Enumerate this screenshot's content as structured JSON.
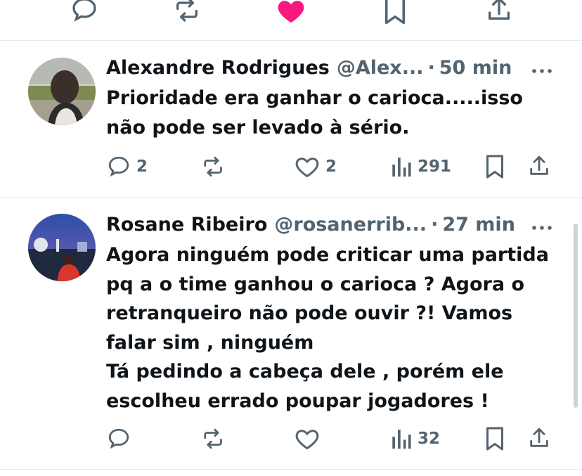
{
  "top_actions": {
    "reply_icon": "reply-icon",
    "retweet_icon": "retweet-icon",
    "like_icon": "heart-filled-icon",
    "like_color": "#f91880",
    "bookmark_icon": "bookmark-icon",
    "share_icon": "share-icon"
  },
  "posts": [
    {
      "name": "Alexandre Rodrigues",
      "handle": "@Alex...",
      "separator": "·",
      "time": "50 min",
      "text_lines": [
        "Prioridade era ganhar o carioca.....isso",
        "não pode ser levado à sério."
      ],
      "replies": "2",
      "retweets": "",
      "likes": "2",
      "views": "291"
    },
    {
      "name": "Rosane Ribeiro",
      "handle": "@rosanerrib...",
      "separator": "·",
      "time": "27 min",
      "text_lines": [
        "Agora ninguém pode criticar uma partida",
        "pq a o time ganhou o carioca ? Agora o",
        "retranqueiro não pode ouvir ?! Vamos",
        "falar sim , ninguém",
        "Tá pedindo a cabeça dele , porém ele",
        "escolheu errado poupar jogadores !"
      ],
      "replies": "",
      "retweets": "",
      "likes": "",
      "views": "32"
    }
  ],
  "colors": {
    "text": "#0f1419",
    "muted": "#536471",
    "divider": "#e6e9ec"
  }
}
